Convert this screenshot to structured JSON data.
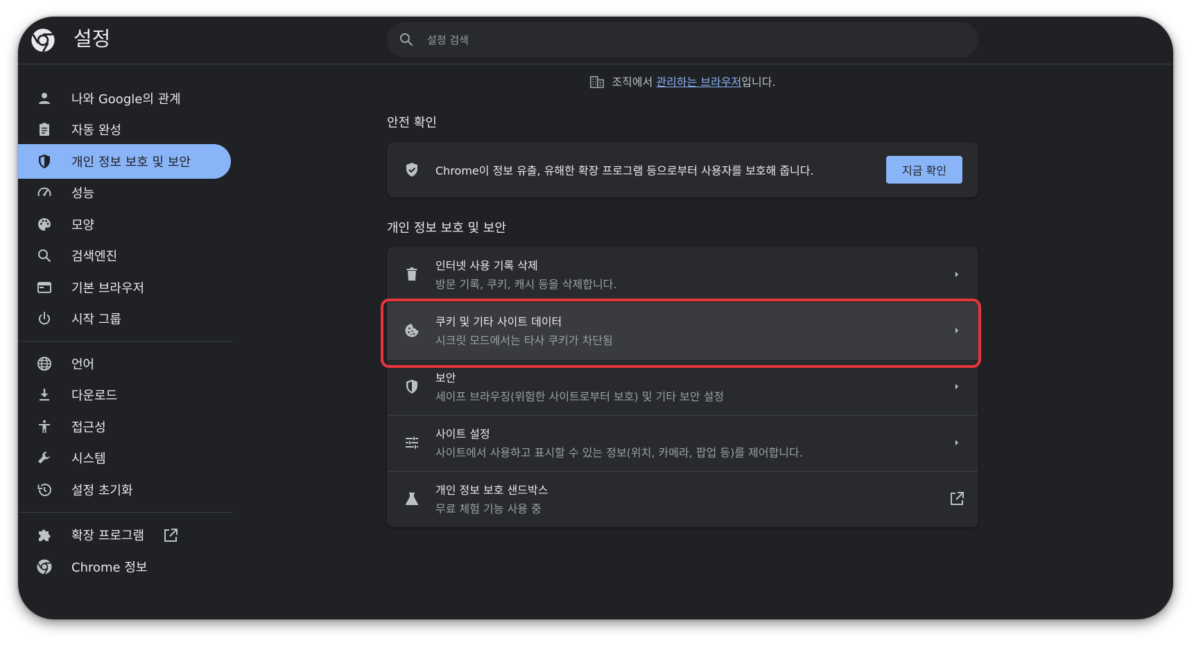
{
  "header": {
    "title": "설정",
    "search_placeholder": "설정 검색"
  },
  "sidebar": {
    "items": [
      {
        "label": "나와 Google의 관계",
        "icon": "person-icon"
      },
      {
        "label": "자동 완성",
        "icon": "clipboard-icon"
      },
      {
        "label": "개인 정보 보호 및 보안",
        "icon": "shield-icon",
        "active": true
      },
      {
        "label": "성능",
        "icon": "speedometer-icon"
      },
      {
        "label": "모양",
        "icon": "palette-icon"
      },
      {
        "label": "검색엔진",
        "icon": "search-icon"
      },
      {
        "label": "기본 브라우저",
        "icon": "browser-icon"
      },
      {
        "label": "시작 그룹",
        "icon": "power-icon"
      },
      {
        "label": "언어",
        "icon": "globe-icon"
      },
      {
        "label": "다운로드",
        "icon": "download-icon"
      },
      {
        "label": "접근성",
        "icon": "accessibility-icon"
      },
      {
        "label": "시스템",
        "icon": "wrench-icon"
      },
      {
        "label": "설정 초기화",
        "icon": "history-icon"
      },
      {
        "label": "확장 프로그램",
        "icon": "puzzle-icon"
      },
      {
        "label": "Chrome 정보",
        "icon": "chrome-icon"
      }
    ]
  },
  "managed": {
    "prefix": "조직에서 ",
    "link": "관리하는 브라우저",
    "suffix": "입니다."
  },
  "safety_check": {
    "title": "안전 확인",
    "text": "Chrome이 정보 유출, 유해한 확장 프로그램 등으로부터 사용자를 보호해 줍니다.",
    "button": "지금 확인"
  },
  "privacy": {
    "title": "개인 정보 보호 및 보안",
    "rows": [
      {
        "title": "인터넷 사용 기록 삭제",
        "sub": "방문 기록, 쿠키, 캐시 등을 삭제합니다.",
        "icon": "trash-icon"
      },
      {
        "title": "쿠키 및 기타 사이트 데이터",
        "sub": "시크릿 모드에서는 타사 쿠키가 차단됨",
        "icon": "cookie-icon"
      },
      {
        "title": "보안",
        "sub": "세이프 브라우징(위험한 사이트로부터 보호) 및 기타 보안 설정",
        "icon": "shield-icon"
      },
      {
        "title": "사이트 설정",
        "sub": "사이트에서 사용하고 표시할 수 있는 정보(위치, 카메라, 팝업 등)를 제어합니다.",
        "icon": "tune-icon"
      },
      {
        "title": "개인 정보 보호 샌드박스",
        "sub": "무료 체험 기능 사용 중",
        "icon": "flask-icon"
      }
    ]
  },
  "colors": {
    "background": "#202124",
    "accent": "#8ab4f8",
    "highlight": "#e8353d"
  }
}
